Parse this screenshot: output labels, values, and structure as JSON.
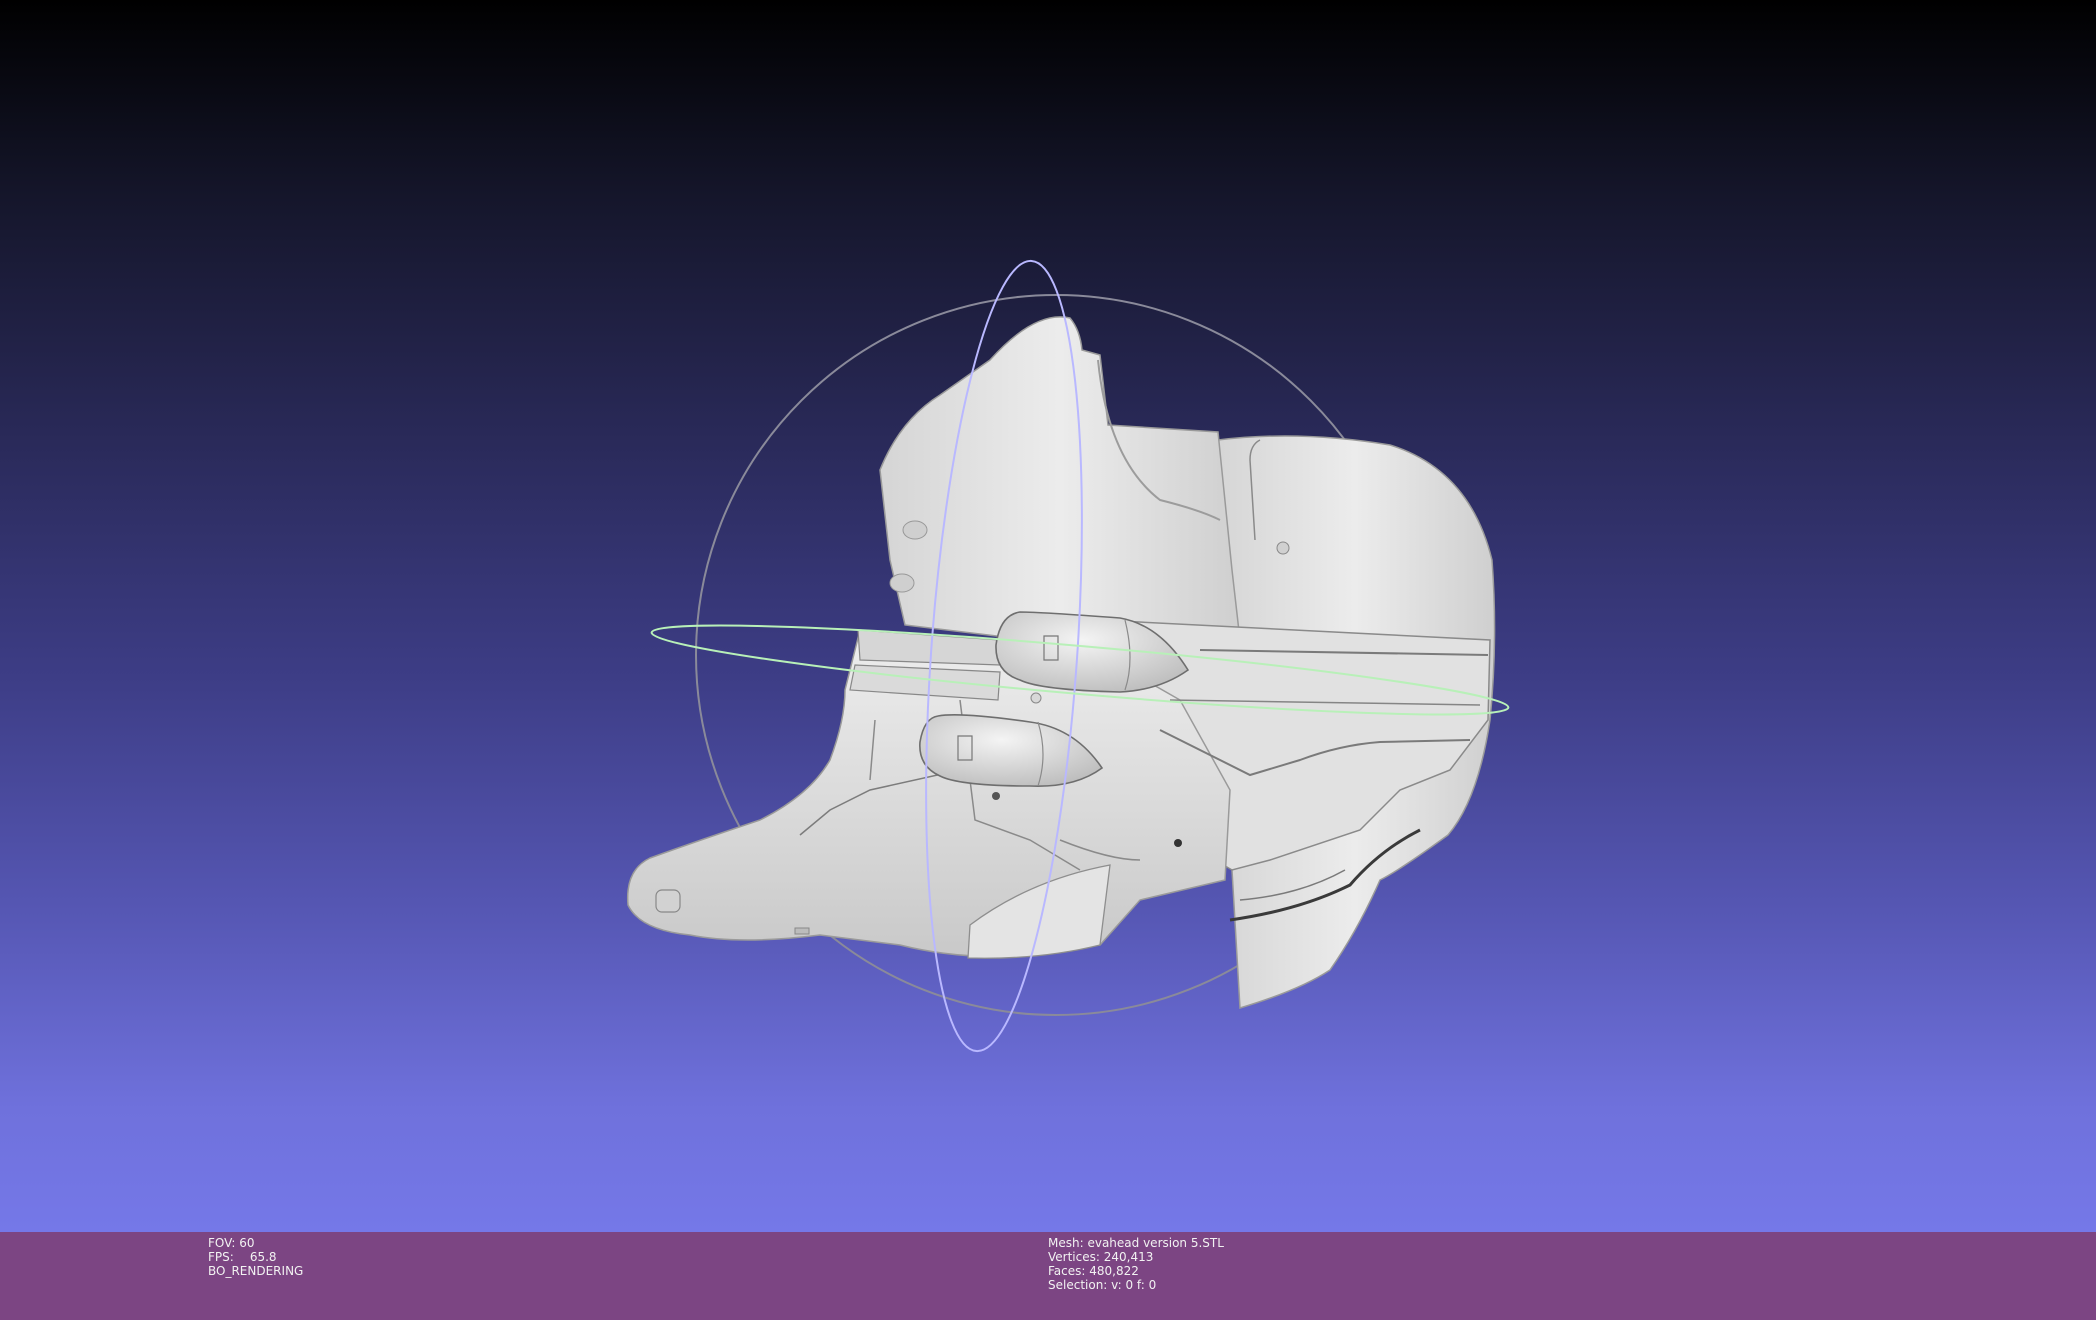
{
  "viewer": {
    "model_description": "3D mesh of a helmet (evahead) with trackball gizmo",
    "background_gradient": [
      "#000000",
      "#2a2a5a",
      "#5657b4",
      "#7578e8"
    ],
    "info_bar_color": "#7c4583",
    "mesh_color": "#e8e8e8",
    "trackball_colors": {
      "outer_circle": "#8a8a9a",
      "vertical_ring": "#b9b8ff",
      "horizontal_ring": "#b8f0b8"
    }
  },
  "info_bar": {
    "left": {
      "fov_label": "FOV:",
      "fov_value": "60",
      "fps_label": "FPS:",
      "fps_value": "65.8",
      "render_mode": "BO_RENDERING"
    },
    "right": {
      "mesh_label": "Mesh:",
      "mesh_value": "evahead version 5.STL",
      "vertices_label": "Vertices:",
      "vertices_value": "240,413",
      "faces_label": "Faces:",
      "faces_value": "480,822",
      "selection_label": "Selection:",
      "selection_value": "v: 0 f: 0"
    }
  }
}
